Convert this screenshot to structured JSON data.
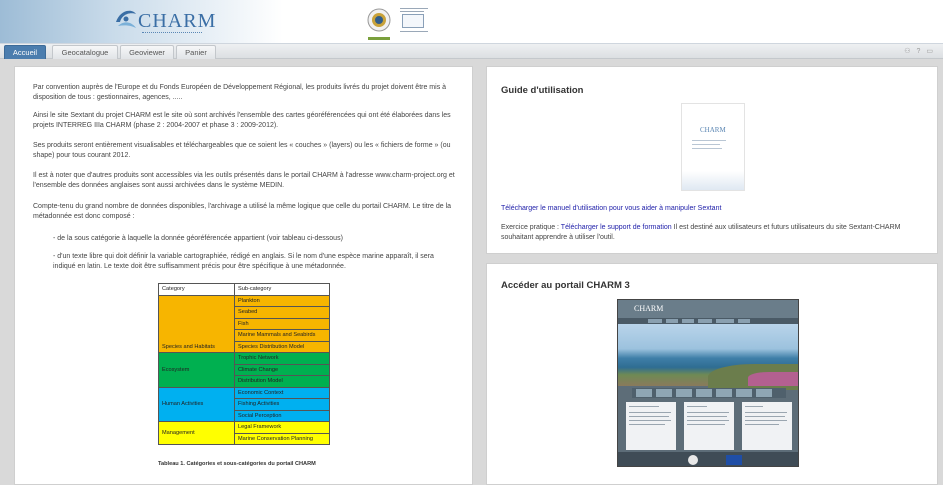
{
  "header": {
    "logo_text": "CHARM"
  },
  "tabs": [
    {
      "label": "Accueil",
      "active": true
    },
    {
      "label": "Geocatalogue",
      "active": false
    },
    {
      "label": "Geoviewer",
      "active": false
    },
    {
      "label": "Panier",
      "active": false
    }
  ],
  "toolbar_icons": [
    "user-icon",
    "help-icon",
    "window-icon"
  ],
  "left": {
    "paragraphs": [
      "Par convention auprès de l'Europe et du Fonds Européen de Développement Régional, les produits livrés du projet doivent être mis à disposition de tous : gestionnaires, agences, .....",
      "Ainsi le site Sextant du projet CHARM est le site où sont archivés l'ensemble des cartes géoréférencées qui ont été élaborées dans les projets INTERREG IIIa CHARM (phase 2 : 2004-2007 et phase 3 : 2009-2012).",
      "Ses produits seront entièrement visualisables et téléchargeables que ce soient les « couches » (layers) ou les « fichiers de forme » (ou shape) pour tous courant 2012.",
      "Il est à noter que d'autres produits sont accessibles via les outils présentés dans le portail CHARM à l'adresse www.charm-project.org et l'ensemble des données anglaises sont aussi archivées dans le système MEDIN.",
      "Compte-tenu du grand nombre de données disponibles, l'archivage a utilisé la même logique que celle du portail CHARM. Le titre de la métadonnée est donc composé :"
    ],
    "bullets": [
      "- de la sous catégorie à laquelle la donnée géoréférencée appartient (voir tableau ci-dessous)",
      "- d'un texte libre qui doit définir la variable cartographiée, rédigé en anglais. Si le nom d'une espèce marine apparaît, il sera indiqué en latin. Le texte doit être suffisamment précis pour être spécifique à une métadonnée."
    ],
    "table": {
      "headers": [
        "Category",
        "Sub-category"
      ],
      "groups": [
        {
          "category": "Species and Habitats",
          "color": "#f7b500",
          "subs": [
            "Plankton",
            "Seabed",
            "Fish",
            "Marine Mammals and Seabirds",
            "Species Distribution Model"
          ]
        },
        {
          "category": "Ecosystem",
          "color": "#00b050",
          "subs": [
            "Trophic Network",
            "Climate Change",
            "Distribution Model"
          ]
        },
        {
          "category": "Human Activities",
          "color": "#00b0f0",
          "subs": [
            "Economic Context",
            "Fishing Activities",
            "Social Perception"
          ]
        },
        {
          "category": "Management",
          "color": "#ffff00",
          "subs": [
            "Legal Framework",
            "Marine Conservation Planning"
          ]
        }
      ],
      "caption": "Tableau 1. Catégories et sous-catégories du portail CHARM"
    }
  },
  "guide": {
    "title": "Guide d'utilisation",
    "download_link": "Télécharger le manuel d'utilisation pour vous aider à manipuler Sextant",
    "exercise_prefix": "Exercice pratique : ",
    "exercise_link": "Télécharger le support de formation",
    "exercise_suffix": " Il est destiné aux utilisateurs et futurs utilisateurs du site  Sextant-CHARM souhaitant apprendre à utiliser l'outil."
  },
  "portal": {
    "title": "Accéder au portail CHARM 3"
  }
}
